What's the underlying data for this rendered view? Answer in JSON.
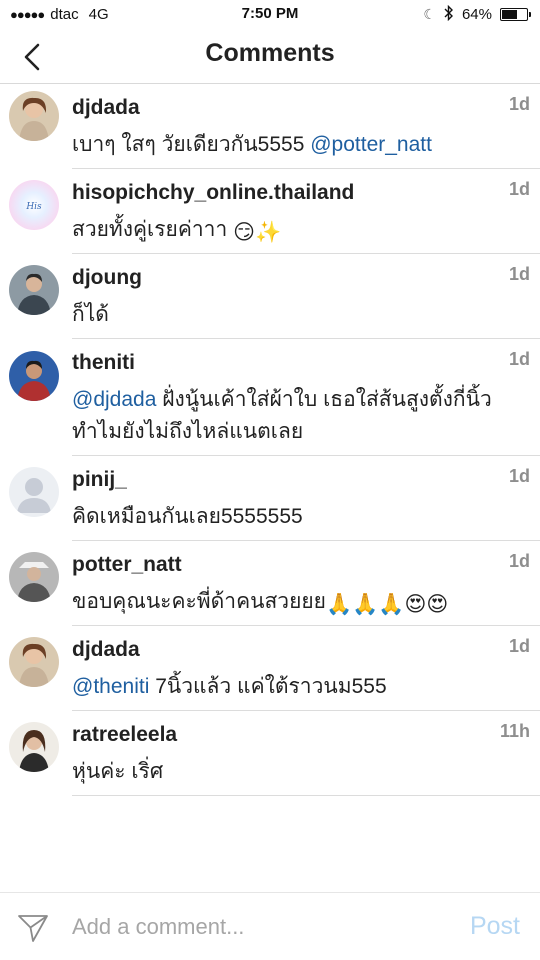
{
  "status_bar": {
    "signal_dots": "●●●●●",
    "carrier": "dtac",
    "network": "4G",
    "time": "7:50 PM",
    "battery_text": "64%",
    "battery_level": 0.64,
    "icons": [
      "moon-icon",
      "bluetooth-icon",
      "battery-icon"
    ]
  },
  "header": {
    "title": "Comments",
    "back_icon": "chevron-left-icon"
  },
  "comments": [
    {
      "username": "djdada",
      "time": "1d",
      "lines": [
        [
          {
            "text": "เบาๆ ใสๆ วัยเดียวกัน5555 "
          },
          {
            "text": "@potter_natt",
            "mention": true
          }
        ]
      ]
    },
    {
      "username": "hisopichchy_online.thailand",
      "time": "1d",
      "lines": [
        [
          {
            "text": "สวยทั้งคู่เรยค่าาา "
          },
          {
            "text": "😏✨",
            "emoji": true
          }
        ]
      ]
    },
    {
      "username": "djoung",
      "time": "1d",
      "lines": [
        [
          {
            "text": "ก็ได้"
          }
        ]
      ]
    },
    {
      "username": "theniti",
      "time": "1d",
      "lines": [
        [
          {
            "text": "@djdada",
            "mention": true
          },
          {
            "text": " ฝั่งนู้นเค้าใส่ผ้าใบ เธอใส่ส้นสูงตั้งกี่นิ้ว"
          }
        ],
        [
          {
            "text": "ทำไมยังไม่ถึงไหล่แนตเลย"
          }
        ]
      ]
    },
    {
      "username": "pinij_",
      "time": "1d",
      "lines": [
        [
          {
            "text": "คิดเหมือนกันเลย5555555"
          }
        ]
      ]
    },
    {
      "username": "potter_natt",
      "time": "1d",
      "lines": [
        [
          {
            "text": "ขอบคุณนะคะพี่ด้าคนสวยยย"
          },
          {
            "text": "🙏🙏🙏😍😍",
            "emoji": true
          }
        ]
      ]
    },
    {
      "username": "djdada",
      "time": "1d",
      "lines": [
        [
          {
            "text": "@theniti",
            "mention": true
          },
          {
            "text": " 7นิ้วแล้ว แค่ใต้ราวนม555"
          }
        ]
      ]
    },
    {
      "username": "ratreeleela",
      "time": "11h",
      "lines": [
        [
          {
            "text": "หุ่นค่ะ เริ่ศ"
          }
        ]
      ]
    }
  ],
  "composer": {
    "placeholder": "Add a comment...",
    "post_label": "Post",
    "send_icon": "paper-plane-icon"
  },
  "colors": {
    "mention": "#1f5fa0",
    "post_disabled": "#b6d7f3",
    "timestamp": "#8e8e8e",
    "divider": "#dcdcdc"
  }
}
